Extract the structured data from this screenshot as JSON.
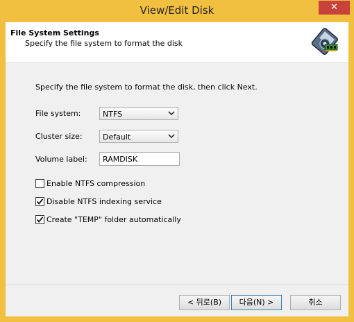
{
  "window": {
    "title": "View/Edit Disk",
    "close_glyph": "✕"
  },
  "header": {
    "title": "File System Settings",
    "subtitle": "Specify the file system to format the disk",
    "icon": "disk-memory-icon"
  },
  "instruction": "Specify the file system to format the disk, then click Next.",
  "fields": {
    "file_system": {
      "label": "File system:",
      "value": "NTFS"
    },
    "cluster_size": {
      "label": "Cluster size:",
      "value": "Default"
    },
    "volume_label": {
      "label": "Volume label:",
      "value": "RAMDISK"
    }
  },
  "checkboxes": [
    {
      "label": "Enable NTFS compression",
      "checked": false
    },
    {
      "label": "Disable NTFS indexing service",
      "checked": true
    },
    {
      "label": "Create \"TEMP\" folder automatically",
      "checked": true
    }
  ],
  "buttons": {
    "back": "< 뒤로(B)",
    "next": "다음(N) >",
    "cancel": "취소"
  },
  "colors": {
    "title_bar": "#f2c040",
    "close": "#c7423a",
    "default_border": "#3c7fb1"
  }
}
